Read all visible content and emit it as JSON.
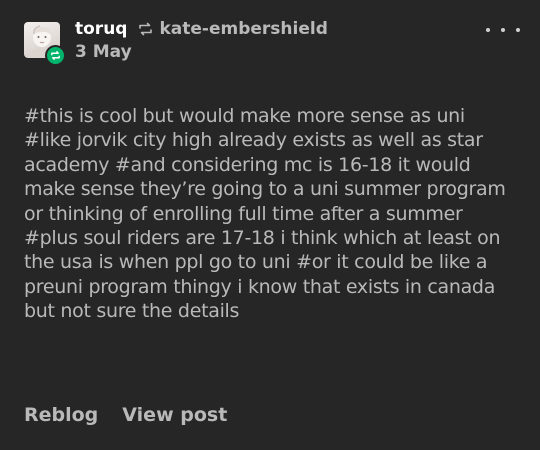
{
  "post": {
    "author": "toruq",
    "reblogged_from": "kate-embershield",
    "date": "3 May",
    "avatar_icon": "user-avatar",
    "badge_icon": "reblog-badge-icon",
    "badge_color": "#00b46c",
    "more_icon": "more-options-icon",
    "tags": [
      "#this is cool but would make more sense as uni",
      "#like jorvik city high already exists as well as star academy",
      "#and considering mc is 16-18 it would make sense they’re going to a uni summer program or thinking of enrolling full time after a summer",
      "#plus soul riders are 17-18 i think which at least on the usa is when ppl go to uni",
      "#or it could be like a preuni program thingy i know that exists in canada but not sure the details"
    ],
    "actions": {
      "reblog_label": "Reblog",
      "view_post_label": "View post"
    }
  },
  "colors": {
    "background": "#262626",
    "primary_text": "#ffffff",
    "secondary_text": "#b9b9b9"
  }
}
